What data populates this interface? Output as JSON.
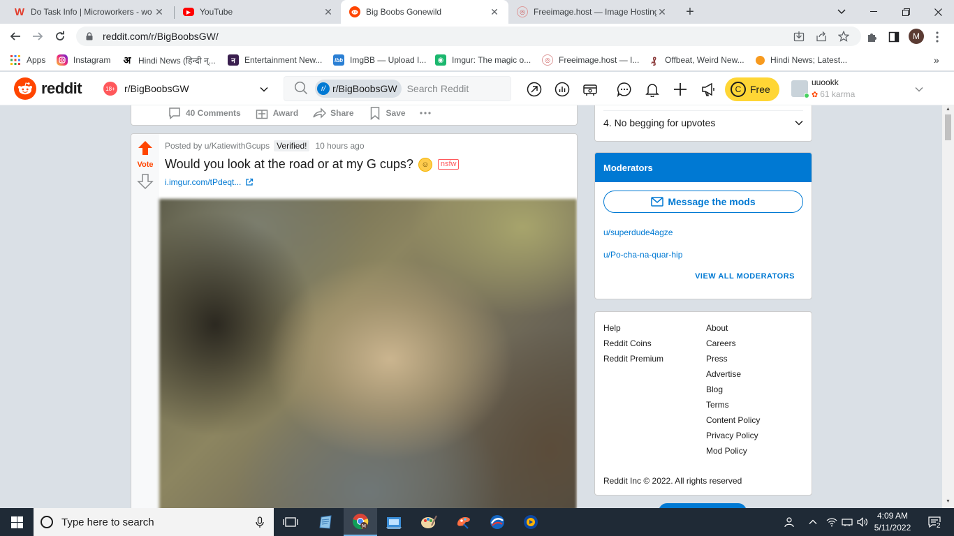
{
  "browser": {
    "tabs": [
      {
        "title": "Do Task Info | Microworkers - wo",
        "icon": "microworkers-icon",
        "favcolor": "#e23c2c",
        "favtext": "W"
      },
      {
        "title": "YouTube",
        "icon": "youtube-icon",
        "favcolor": "#ff0000",
        "favtext": "▶"
      },
      {
        "title": "Big Boobs Gonewild",
        "icon": "reddit-icon",
        "favcolor": "#ff4500",
        "favtext": ""
      },
      {
        "title": "Freeimage.host — Image Hosting",
        "icon": "freeimage-icon",
        "favcolor": "#ffffff",
        "favtext": "◎"
      }
    ],
    "url": "reddit.com/r/BigBoobsGW/",
    "profile_initial": "M",
    "bookmarks": [
      {
        "label": "Apps"
      },
      {
        "label": "Instagram"
      },
      {
        "label": "Hindi News (हिन्दी न्..."
      },
      {
        "label": "Entertainment New..."
      },
      {
        "label": "ImgBB — Upload I..."
      },
      {
        "label": "Imgur: The magic o..."
      },
      {
        "label": "Freeimage.host — I..."
      },
      {
        "label": "Offbeat, Weird New..."
      },
      {
        "label": "Hindi News; Latest..."
      }
    ]
  },
  "reddit": {
    "wordmark": "reddit",
    "community_badge": "18+",
    "community": "r/BigBoobsGW",
    "search_chip": "r/BigBoobsGW",
    "search_chip_icon": "r/",
    "search_placeholder": "Search Reddit",
    "free_label": "Free",
    "coin_symbol": "C",
    "username": "uuookk",
    "karma": "61 karma"
  },
  "prev_post_actions": {
    "comments": "40 Comments",
    "award": "Award",
    "share": "Share",
    "save": "Save"
  },
  "post": {
    "vote_label": "Vote",
    "posted_by": "Posted by u/KatiewithGcups",
    "flair": "Verified!",
    "time": "10 hours ago",
    "title": "Would you look at the road or at my G cups?",
    "nsfw": "nsfw",
    "link": "i.imgur.com/tPdeqt..."
  },
  "sidebar": {
    "rule": "4. No begging for upvotes",
    "moderators_title": "Moderators",
    "message_mods": "Message the mods",
    "mods": [
      "u/superdude4agze",
      "u/Po-cha-na-quar-hip"
    ],
    "view_all": "VIEW ALL MODERATORS",
    "footer_left": [
      "Help",
      "Reddit Coins",
      "Reddit Premium"
    ],
    "footer_right": [
      "About",
      "Careers",
      "Press",
      "Advertise",
      "Blog",
      "Terms",
      "Content Policy",
      "Privacy Policy",
      "Mod Policy"
    ],
    "copyright": "Reddit Inc © 2022. All rights reserved"
  },
  "taskbar": {
    "search_placeholder": "Type here to search",
    "time": "4:09 AM",
    "date": "5/11/2022",
    "notification_count": "2"
  },
  "colors": {
    "reddit_orange": "#ff4500",
    "reddit_blue": "#0079d3",
    "coins_yellow": "#ffd635"
  }
}
